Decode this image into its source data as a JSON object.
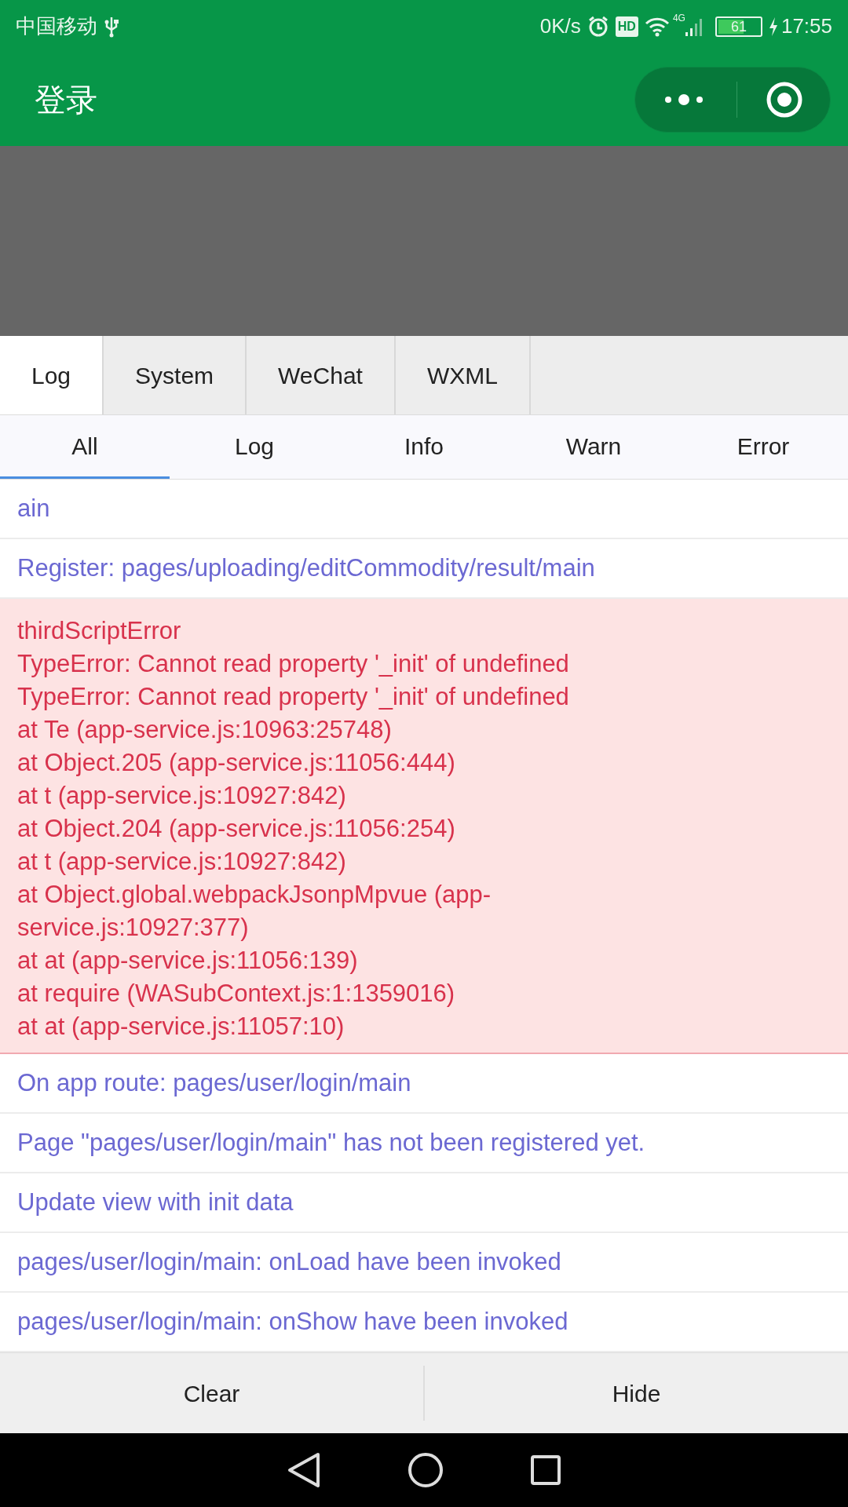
{
  "status_bar": {
    "carrier": "中国移动",
    "speed": "0K/s",
    "hd": "HD",
    "network": "4G",
    "battery": "61",
    "level": 0.61,
    "time": "17:55"
  },
  "nav": {
    "title": "登录"
  },
  "tabs": [
    {
      "label": "Log",
      "selected": true
    },
    {
      "label": "System",
      "selected": false
    },
    {
      "label": "WeChat",
      "selected": false
    },
    {
      "label": "WXML",
      "selected": false
    }
  ],
  "filters": [
    {
      "label": "All",
      "selected": true
    },
    {
      "label": "Log",
      "selected": false
    },
    {
      "label": "Info",
      "selected": false
    },
    {
      "label": "Warn",
      "selected": false
    },
    {
      "label": "Error",
      "selected": false
    }
  ],
  "entries": [
    {
      "kind": "log",
      "lines": [
        "ain"
      ]
    },
    {
      "kind": "log",
      "lines": [
        "Register: pages/uploading/editCommodity/result/main"
      ]
    },
    {
      "kind": "error",
      "lines": [
        "thirdScriptError",
        "TypeError: Cannot read property '_init' of undefined",
        "TypeError: Cannot read property '_init' of undefined",
        "at Te (app-service.js:10963:25748)",
        "at Object.205 (app-service.js:11056:444)",
        "at t (app-service.js:10927:842)",
        "at Object.204 (app-service.js:11056:254)",
        "at t (app-service.js:10927:842)",
        "at Object.global.webpackJsonpMpvue (app-service.js:10927:377)",
        "at at (app-service.js:11056:139)",
        "at require (WASubContext.js:1:1359016)",
        "at at (app-service.js:11057:10)"
      ]
    },
    {
      "kind": "log",
      "lines": [
        "On app route: pages/user/login/main"
      ]
    },
    {
      "kind": "log",
      "lines": [
        "Page \"pages/user/login/main\" has not been registered yet."
      ]
    },
    {
      "kind": "log",
      "lines": [
        "Update view with init data"
      ]
    },
    {
      "kind": "log",
      "lines": [
        "pages/user/login/main: onLoad have been invoked"
      ]
    },
    {
      "kind": "log",
      "lines": [
        "pages/user/login/main: onShow have been invoked"
      ]
    }
  ],
  "buttons": [
    "Clear",
    "Hide"
  ]
}
